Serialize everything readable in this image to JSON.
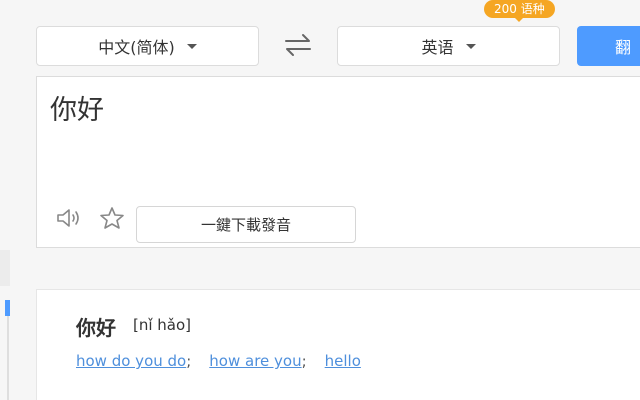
{
  "translator": {
    "source_language": "中文(简体)",
    "target_language": "英语",
    "language_count_badge": "200 语种",
    "translate_button": "翻",
    "source_text": "你好",
    "download_audio_button": "一鍵下載發音"
  },
  "result": {
    "word": "你好",
    "phonetic": "[nǐ hǎo]",
    "meanings": [
      "how do you do",
      "how are you",
      "hello"
    ],
    "separator": ";"
  },
  "colors": {
    "accent_blue": "#4e9bff",
    "badge_orange": "#f5a623",
    "link_blue": "#4e8fdc"
  },
  "icons": {
    "swap": "swap-icon",
    "speaker": "speaker-icon",
    "star": "star-icon",
    "caret": "caret-down-icon"
  }
}
